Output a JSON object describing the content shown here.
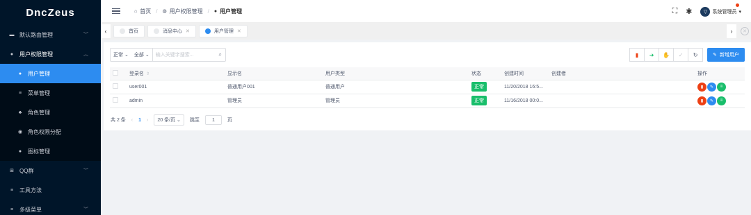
{
  "app": {
    "name": "DncZeus"
  },
  "sidebar": {
    "items": [
      {
        "label": "默认路由管理",
        "icon": "list-icon",
        "expanded": false
      },
      {
        "label": "用户权限管理",
        "icon": "user-group-icon",
        "expanded": true,
        "children": [
          {
            "label": "用户管理",
            "icon": "user-icon",
            "active": true
          },
          {
            "label": "菜单管理",
            "icon": "menu-icon",
            "active": false
          },
          {
            "label": "角色管理",
            "icon": "role-icon",
            "active": false
          },
          {
            "label": "角色权限分配",
            "icon": "permission-icon",
            "active": false
          },
          {
            "label": "图标管理",
            "icon": "icon-manage-icon",
            "active": false
          }
        ]
      },
      {
        "label": "QQ群",
        "icon": "grid-icon",
        "expanded": false
      },
      {
        "label": "工具方法",
        "icon": "tool-icon",
        "expanded": false
      },
      {
        "label": "多级菜单",
        "icon": "menu-icon",
        "expanded": false
      }
    ]
  },
  "header": {
    "breadcrumb": [
      "首页",
      "用户权限管理",
      "用户管理"
    ],
    "user_name": "系统管理员"
  },
  "tabs": [
    {
      "label": "首页",
      "closable": false,
      "active": false
    },
    {
      "label": "消息中心",
      "closable": true,
      "active": false
    },
    {
      "label": "用户管理",
      "closable": true,
      "active": true
    }
  ],
  "toolbar": {
    "status_filter": "正常",
    "type_filter": "全部",
    "search_placeholder": "输入关键字搜索...",
    "new_user_label": "新增用户"
  },
  "table": {
    "columns": [
      "登录名",
      "显示名",
      "用户类型",
      "状态",
      "创建时间",
      "创建者",
      "操作"
    ],
    "rows": [
      {
        "login": "user001",
        "display": "普通用户001",
        "type": "普通用户",
        "status": "正常",
        "created": "11/20/2018 16:5...",
        "creator": ""
      },
      {
        "login": "admin",
        "display": "管理员",
        "type": "管理员",
        "status": "正常",
        "created": "11/16/2018 00:0...",
        "creator": ""
      }
    ]
  },
  "pagination": {
    "total_text": "共 2 条",
    "current_page": "1",
    "page_size": "20 条/页",
    "jump_label": "跳至",
    "jump_value": "1",
    "page_suffix": "页"
  },
  "colors": {
    "sidebar_bg": "#001529",
    "primary": "#2d8cf0",
    "success": "#19be6b",
    "danger": "#ed4014"
  }
}
